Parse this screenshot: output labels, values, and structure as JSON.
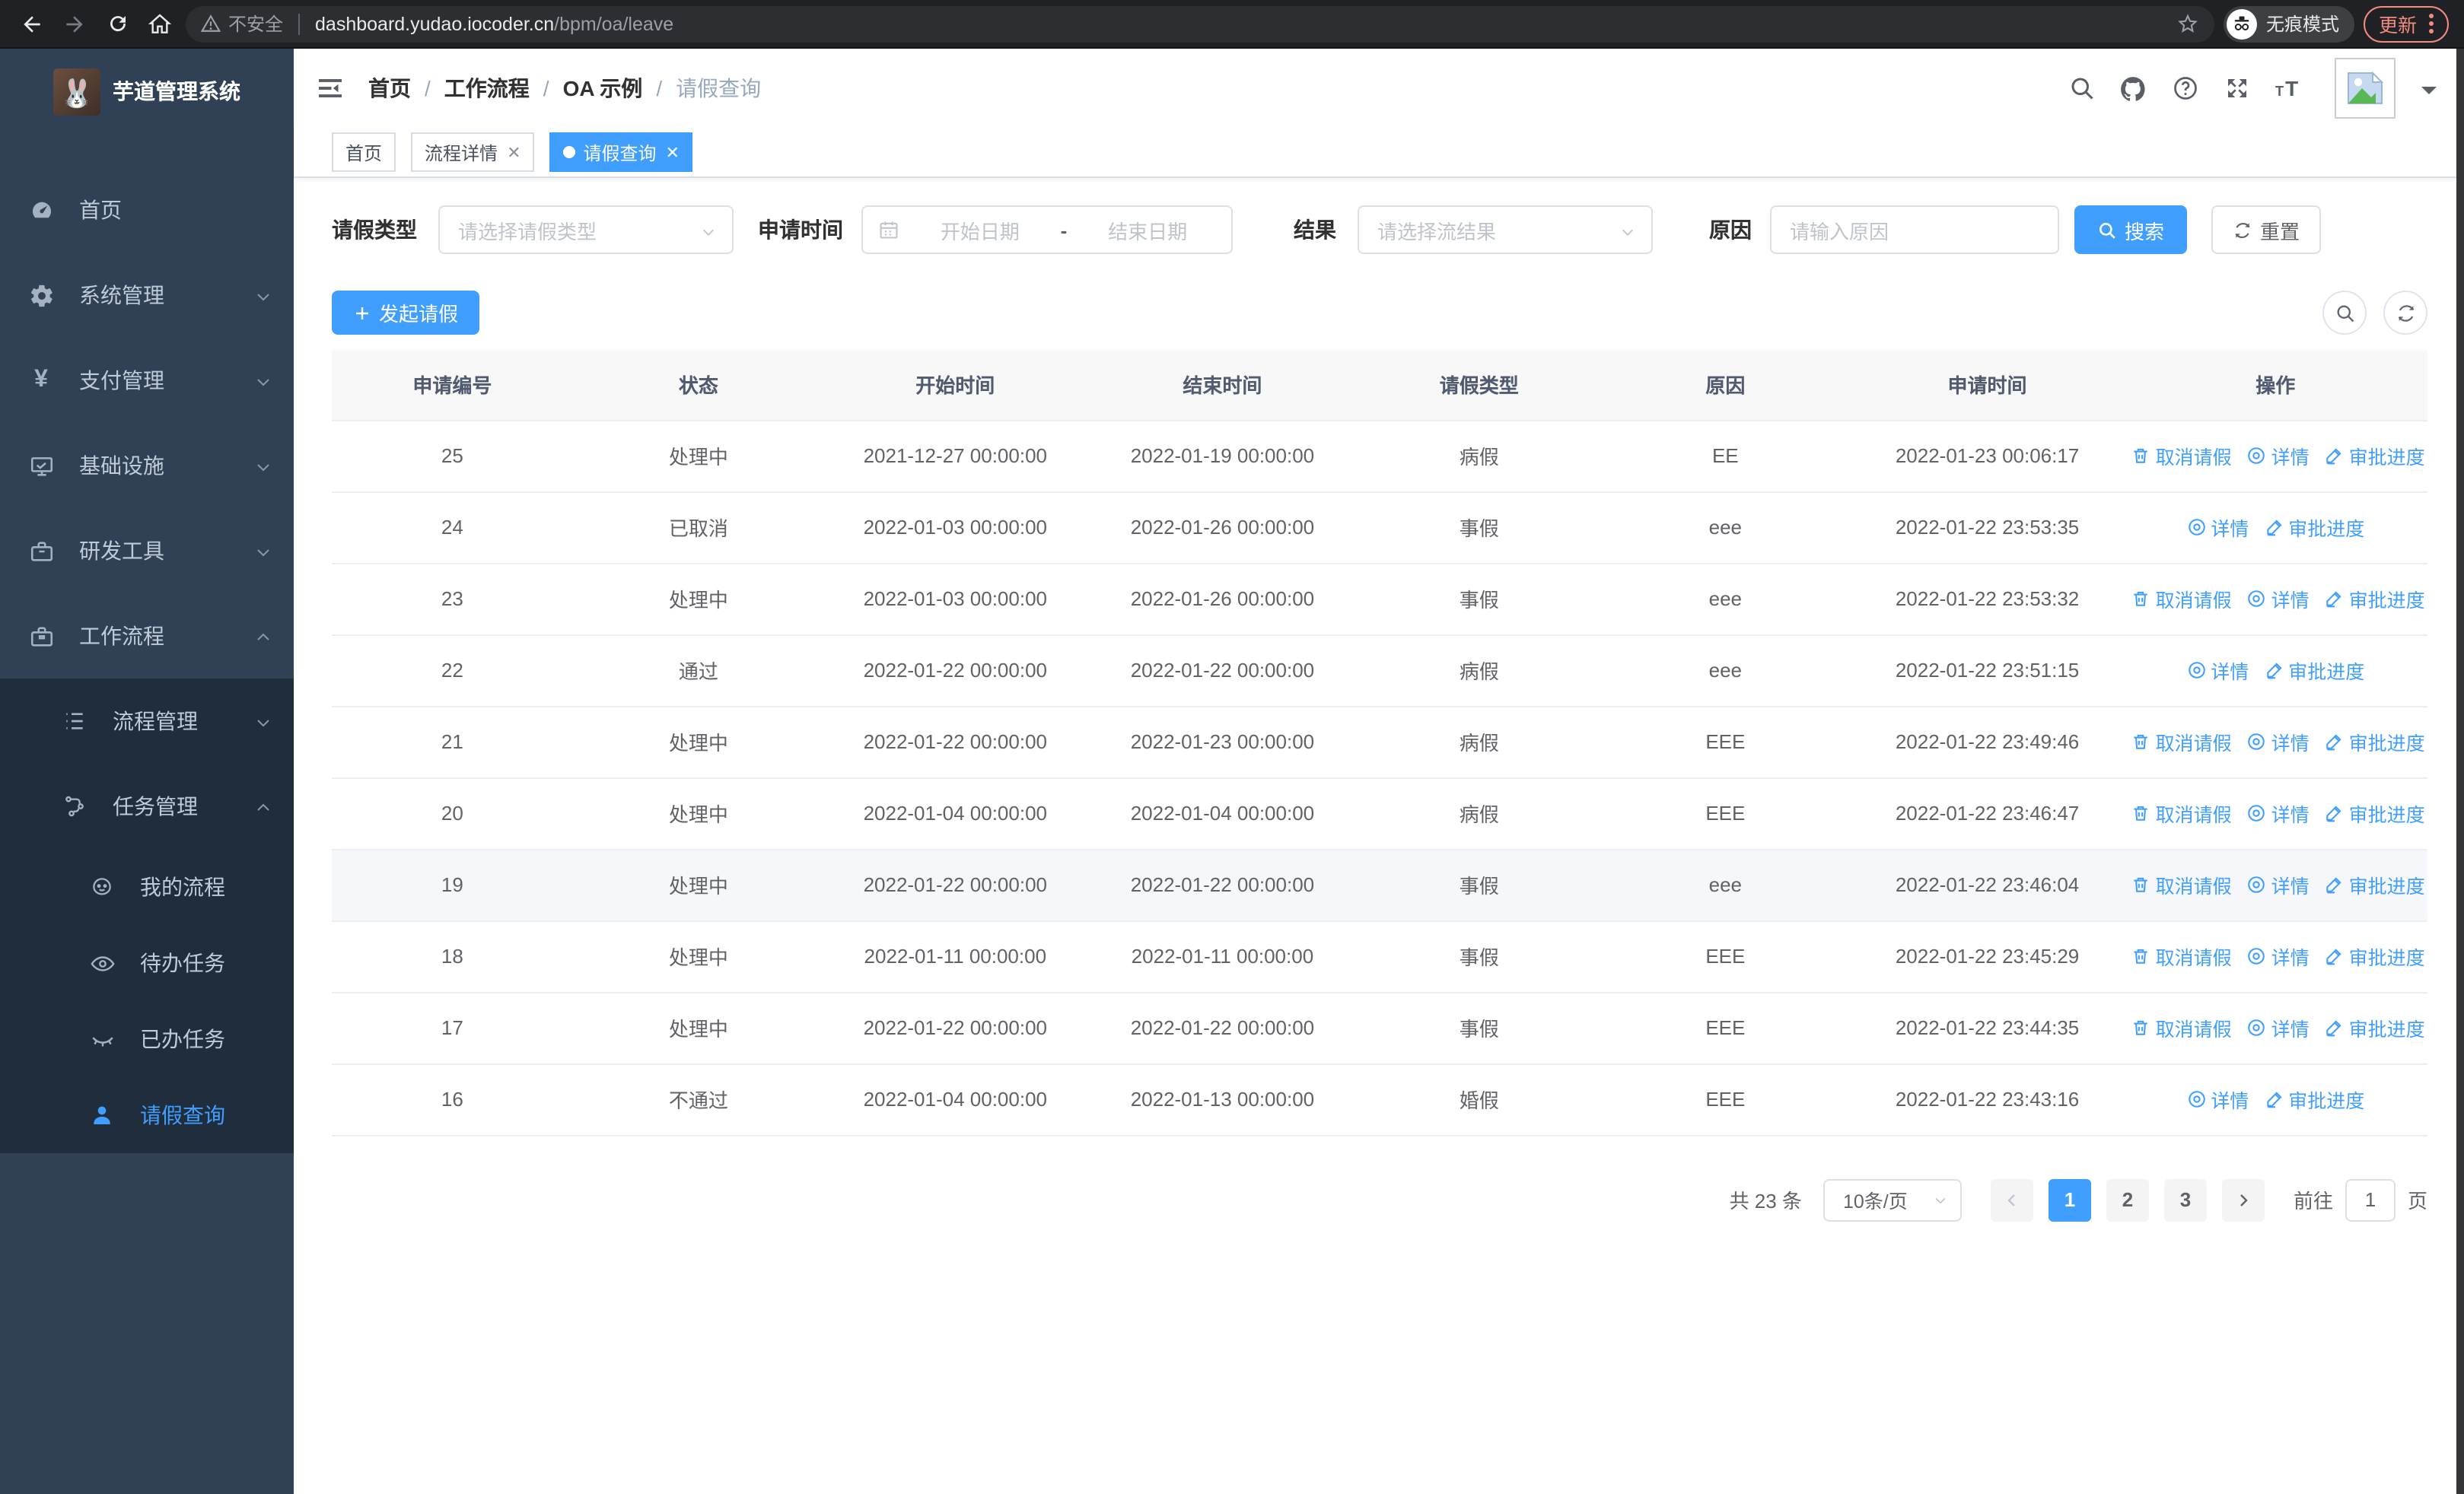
{
  "browser": {
    "security_label": "不安全",
    "url_host": "dashboard.yudao.iocoder.cn",
    "url_path": "/bpm/oa/leave",
    "incognito_label": "无痕模式",
    "update_label": "更新"
  },
  "sidebar": {
    "app_title": "芋道管理系统",
    "items": [
      {
        "label": "首页",
        "icon": "dashboard-icon"
      },
      {
        "label": "系统管理",
        "icon": "gear-icon"
      },
      {
        "label": "支付管理",
        "icon": "yen-icon"
      },
      {
        "label": "基础设施",
        "icon": "monitor-icon"
      },
      {
        "label": "研发工具",
        "icon": "toolbox-icon"
      },
      {
        "label": "工作流程",
        "icon": "briefcase-icon"
      }
    ],
    "submenu": [
      {
        "label": "流程管理",
        "icon": "tree-list-icon"
      },
      {
        "label": "任务管理",
        "icon": "flow-icon"
      }
    ],
    "task_items": [
      {
        "label": "我的流程",
        "icon": "face-icon"
      },
      {
        "label": "待办任务",
        "icon": "eye-open-icon"
      },
      {
        "label": "已办任务",
        "icon": "eye-closed-icon"
      },
      {
        "label": "请假查询",
        "icon": "person-icon"
      }
    ]
  },
  "header": {
    "breadcrumb": [
      "首页",
      "工作流程",
      "OA 示例",
      "请假查询"
    ]
  },
  "tabs": [
    {
      "label": "首页",
      "closable": false,
      "active": false
    },
    {
      "label": "流程详情",
      "closable": true,
      "active": false
    },
    {
      "label": "请假查询",
      "closable": true,
      "active": true
    }
  ],
  "filters": {
    "leave_type_label": "请假类型",
    "leave_type_placeholder": "请选择请假类型",
    "apply_time_label": "申请时间",
    "date_start_placeholder": "开始日期",
    "date_separator": "-",
    "date_end_placeholder": "结束日期",
    "result_label": "结果",
    "result_placeholder": "请选择流结果",
    "reason_label": "原因",
    "reason_placeholder": "请输入原因",
    "search_label": "搜索",
    "reset_label": "重置"
  },
  "toolbar": {
    "create_label": "发起请假"
  },
  "table": {
    "columns": [
      "申请编号",
      "状态",
      "开始时间",
      "结束时间",
      "请假类型",
      "原因",
      "申请时间",
      "操作"
    ],
    "action_labels": {
      "cancel": "取消请假",
      "detail": "详情",
      "progress": "审批进度"
    },
    "rows": [
      {
        "id": "25",
        "status": "处理中",
        "start": "2021-12-27 00:00:00",
        "end": "2022-01-19 00:00:00",
        "type": "病假",
        "reason": "EE",
        "applied": "2022-01-23 00:06:17",
        "can_cancel": true,
        "highlight": false
      },
      {
        "id": "24",
        "status": "已取消",
        "start": "2022-01-03 00:00:00",
        "end": "2022-01-26 00:00:00",
        "type": "事假",
        "reason": "eee",
        "applied": "2022-01-22 23:53:35",
        "can_cancel": false,
        "highlight": false
      },
      {
        "id": "23",
        "status": "处理中",
        "start": "2022-01-03 00:00:00",
        "end": "2022-01-26 00:00:00",
        "type": "事假",
        "reason": "eee",
        "applied": "2022-01-22 23:53:32",
        "can_cancel": true,
        "highlight": false
      },
      {
        "id": "22",
        "status": "通过",
        "start": "2022-01-22 00:00:00",
        "end": "2022-01-22 00:00:00",
        "type": "病假",
        "reason": "eee",
        "applied": "2022-01-22 23:51:15",
        "can_cancel": false,
        "highlight": false
      },
      {
        "id": "21",
        "status": "处理中",
        "start": "2022-01-22 00:00:00",
        "end": "2022-01-23 00:00:00",
        "type": "病假",
        "reason": "EEE",
        "applied": "2022-01-22 23:49:46",
        "can_cancel": true,
        "highlight": false
      },
      {
        "id": "20",
        "status": "处理中",
        "start": "2022-01-04 00:00:00",
        "end": "2022-01-04 00:00:00",
        "type": "病假",
        "reason": "EEE",
        "applied": "2022-01-22 23:46:47",
        "can_cancel": true,
        "highlight": false
      },
      {
        "id": "19",
        "status": "处理中",
        "start": "2022-01-22 00:00:00",
        "end": "2022-01-22 00:00:00",
        "type": "事假",
        "reason": "eee",
        "applied": "2022-01-22 23:46:04",
        "can_cancel": true,
        "highlight": true
      },
      {
        "id": "18",
        "status": "处理中",
        "start": "2022-01-11 00:00:00",
        "end": "2022-01-11 00:00:00",
        "type": "事假",
        "reason": "EEE",
        "applied": "2022-01-22 23:45:29",
        "can_cancel": true,
        "highlight": false
      },
      {
        "id": "17",
        "status": "处理中",
        "start": "2022-01-22 00:00:00",
        "end": "2022-01-22 00:00:00",
        "type": "事假",
        "reason": "EEE",
        "applied": "2022-01-22 23:44:35",
        "can_cancel": true,
        "highlight": false
      },
      {
        "id": "16",
        "status": "不通过",
        "start": "2022-01-04 00:00:00",
        "end": "2022-01-13 00:00:00",
        "type": "婚假",
        "reason": "EEE",
        "applied": "2022-01-22 23:43:16",
        "can_cancel": false,
        "highlight": false
      }
    ]
  },
  "pagination": {
    "total_label": "共 23 条",
    "page_size": "10条/页",
    "pages": [
      "1",
      "2",
      "3"
    ],
    "active_page": "1",
    "goto_label": "前往",
    "goto_value": "1",
    "goto_suffix": "页"
  },
  "colors": {
    "primary": "#409eff",
    "sidebar_bg": "#304156",
    "submenu_bg": "#1f2d3d",
    "chrome_bg": "#202124",
    "update_accent": "#f28b82"
  }
}
